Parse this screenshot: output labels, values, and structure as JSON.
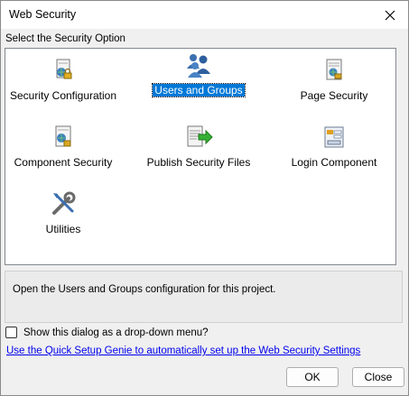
{
  "window": {
    "title": "Web Security",
    "close_icon": "close-icon"
  },
  "section_label": "Select the Security Option",
  "options": [
    {
      "label": "Security Configuration",
      "icon": "security-configuration-icon",
      "selected": false
    },
    {
      "label": "Users and Groups",
      "icon": "users-and-groups-icon",
      "selected": true
    },
    {
      "label": "Page Security",
      "icon": "page-security-icon",
      "selected": false
    },
    {
      "label": "Component Security",
      "icon": "component-security-icon",
      "selected": false
    },
    {
      "label": "Publish Security Files",
      "icon": "publish-security-files-icon",
      "selected": false
    },
    {
      "label": "Login Component",
      "icon": "login-component-icon",
      "selected": false
    },
    {
      "label": "Utilities",
      "icon": "utilities-icon",
      "selected": false
    }
  ],
  "description": "Open the Users and Groups configuration for this project.",
  "dropdown_checkbox": {
    "label": "Show this dialog as a drop-down menu?",
    "checked": false
  },
  "genie_link": "Use the Quick Setup Genie to automatically set up the Web Security Settings",
  "buttons": {
    "ok": "OK",
    "close": "Close"
  },
  "colors": {
    "selection": "#0078d7",
    "link": "#0000ee",
    "panel_bg": "#ffffff",
    "dialog_bg": "#f0f0f0"
  }
}
